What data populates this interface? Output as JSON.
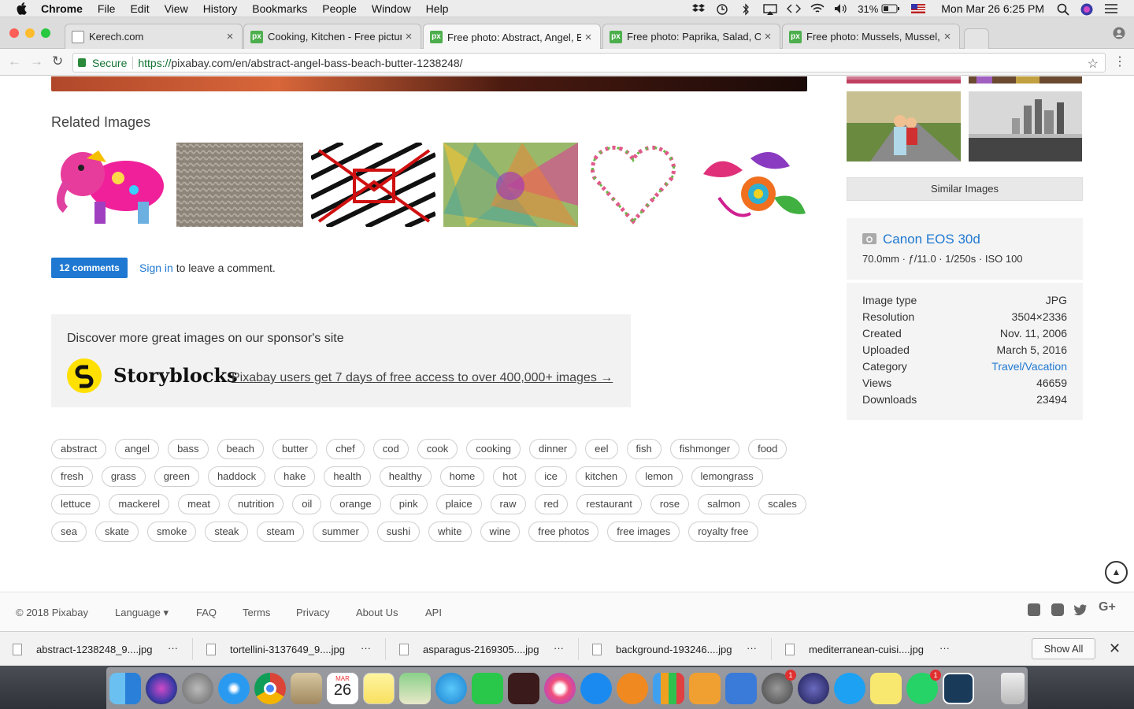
{
  "menubar": {
    "app": "Chrome",
    "items": [
      "File",
      "Edit",
      "View",
      "History",
      "Bookmarks",
      "People",
      "Window",
      "Help"
    ],
    "battery": "31%",
    "datetime": "Mon Mar 26  6:25 PM"
  },
  "tabs": [
    {
      "title": "Kerech.com",
      "favicon": "doc-icon"
    },
    {
      "title": "Cooking, Kitchen - Free picture",
      "favicon": "pixabay-icon"
    },
    {
      "title": "Free photo: Abstract, Angel, B",
      "favicon": "pixabay-icon",
      "active": true
    },
    {
      "title": "Free photo: Paprika, Salad, Ora",
      "favicon": "pixabay-icon"
    },
    {
      "title": "Free photo: Mussels, Mussel, S",
      "favicon": "pixabay-icon"
    }
  ],
  "address": {
    "secure_label": "Secure",
    "scheme": "https://",
    "url": "pixabay.com/en/abstract-angel-bass-beach-butter-1238248/"
  },
  "related": {
    "title": "Related Images"
  },
  "comments": {
    "button": "12 comments",
    "signin": "Sign in",
    "rest": " to leave a comment."
  },
  "sponsor": {
    "title": "Discover more great images on our sponsor's site",
    "brand": "Storyblocks",
    "link": "Pixabay users get 7 days of free access to over 400,000+ images →"
  },
  "tag_rows": [
    [
      "abstract",
      "angel",
      "bass",
      "beach",
      "butter",
      "chef",
      "cod",
      "cook",
      "cooking",
      "dinner",
      "eel",
      "fish",
      "fishmonger",
      "food"
    ],
    [
      "fresh",
      "grass",
      "green",
      "haddock",
      "hake",
      "health",
      "healthy",
      "home",
      "hot",
      "ice",
      "kitchen",
      "lemon",
      "lemongrass"
    ],
    [
      "lettuce",
      "mackerel",
      "meat",
      "nutrition",
      "oil",
      "orange",
      "pink",
      "plaice",
      "raw",
      "red",
      "restaurant",
      "rose",
      "salmon",
      "scales"
    ],
    [
      "sea",
      "skate",
      "smoke",
      "steak",
      "steam",
      "summer",
      "sushi",
      "white",
      "wine",
      "free photos",
      "free images",
      "royalty free"
    ]
  ],
  "similar_button": "Similar Images",
  "camera": {
    "name": "Canon EOS 30d",
    "exif": "70.0mm · ƒ/11.0 · 1/250s · ISO 100"
  },
  "info": [
    {
      "k": "Image type",
      "v": "JPG"
    },
    {
      "k": "Resolution",
      "v": "3504×2336"
    },
    {
      "k": "Created",
      "v": "Nov. 11, 2006"
    },
    {
      "k": "Uploaded",
      "v": "March 5, 2016"
    },
    {
      "k": "Category",
      "v": "Travel/Vacation",
      "link": true
    },
    {
      "k": "Views",
      "v": "46659"
    },
    {
      "k": "Downloads",
      "v": "23494"
    }
  ],
  "footer": {
    "copyright": "© 2018 Pixabay",
    "language": "Language ▾",
    "faq": "FAQ",
    "terms": "Terms",
    "privacy": "Privacy",
    "about": "About Us",
    "api": "API"
  },
  "downloads": [
    "abstract-1238248_9....jpg",
    "tortellini-3137649_9....jpg",
    "asparagus-2169305....jpg",
    "background-193246....jpg",
    "mediterranean-cuisi....jpg"
  ],
  "show_all": "Show All",
  "dock": {
    "calendar_month": "MAR",
    "calendar_day": "26",
    "badge_count": "1"
  }
}
